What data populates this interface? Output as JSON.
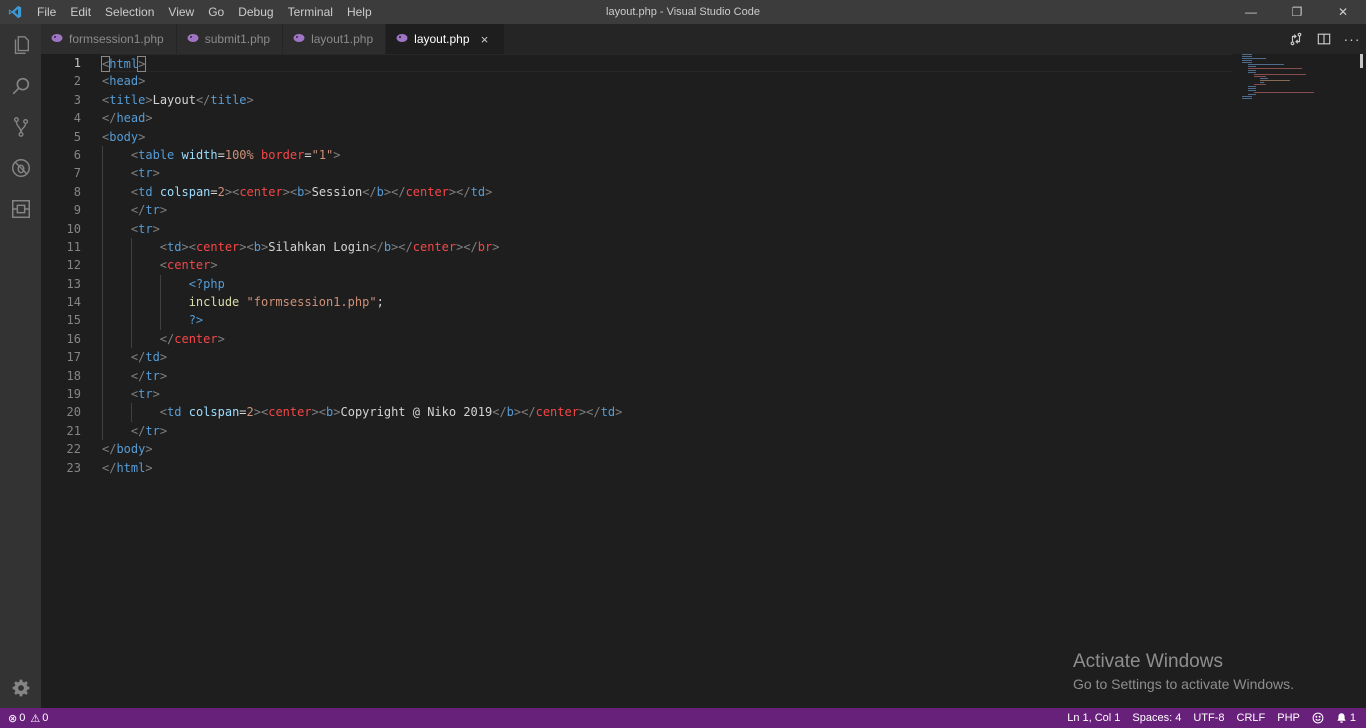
{
  "window": {
    "title": "layout.php - Visual Studio Code",
    "controls": {
      "minimize": "—",
      "maximize": "❐",
      "close": "✕"
    }
  },
  "menu": [
    "File",
    "Edit",
    "Selection",
    "View",
    "Go",
    "Debug",
    "Terminal",
    "Help"
  ],
  "tabs": [
    {
      "label": "formsession1.php",
      "active": false
    },
    {
      "label": "submit1.php",
      "active": false
    },
    {
      "label": "layout1.php",
      "active": false
    },
    {
      "label": "layout.php",
      "active": true,
      "close": "×"
    }
  ],
  "editor": {
    "line_numbers": [
      "1",
      "2",
      "3",
      "4",
      "5",
      "6",
      "7",
      "8",
      "9",
      "10",
      "11",
      "12",
      "13",
      "14",
      "15",
      "16",
      "17",
      "18",
      "19",
      "20",
      "21",
      "22",
      "23"
    ],
    "current_line": 1
  },
  "code_text": {
    "title_text": "Layout",
    "width_val": "100%",
    "border_val": "\"1\"",
    "colspan_val": "2",
    "session": "Session",
    "login": "Silahkan Login",
    "php_open": "<?php",
    "include_kw": "include",
    "include_file": "\"formsession1.php\"",
    "php_close": "?>",
    "copyright": "Copyright @ Niko 2019"
  },
  "watermark": {
    "title": "Activate Windows",
    "subtitle": "Go to Settings to activate Windows."
  },
  "statusbar": {
    "errors": "0",
    "warnings": "0",
    "position": "Ln 1, Col 1",
    "spaces": "Spaces: 4",
    "encoding": "UTF-8",
    "eol": "CRLF",
    "language": "PHP",
    "notifications": "1"
  },
  "colors": {
    "statusbar": "#68217a",
    "activitybar": "#333333",
    "editor_bg": "#1e1e1e",
    "tag": "#569cd6",
    "center_tag": "#f44747"
  }
}
